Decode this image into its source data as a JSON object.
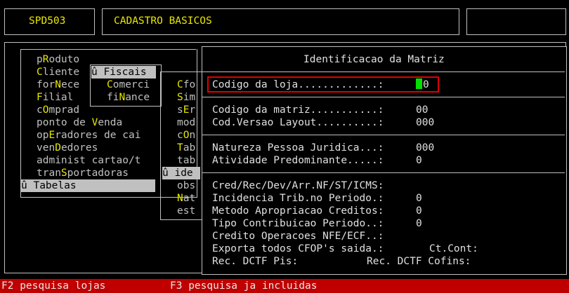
{
  "header": {
    "program_code": "SPD503",
    "screen_title": "CADASTRO BASICOS"
  },
  "main_menu": {
    "items": [
      {
        "prefix": "p",
        "hot": "R",
        "rest": "oduto"
      },
      {
        "prefix": "",
        "hot": "C",
        "rest": "liente"
      },
      {
        "prefix": "for",
        "hot": "N",
        "rest": "ece"
      },
      {
        "prefix": "",
        "hot": "F",
        "rest": "ilial"
      },
      {
        "prefix": "c",
        "hot": "O",
        "rest": "mprad"
      },
      {
        "prefix": "ponto de ",
        "hot": "V",
        "rest": "enda"
      },
      {
        "prefix": "op",
        "hot": "E",
        "rest": "radores de cai"
      },
      {
        "prefix": "ven",
        "hot": "D",
        "rest": "edores"
      },
      {
        "prefix": "administ cartao/t",
        "hot": "",
        "rest": ""
      },
      {
        "prefix": "tran",
        "hot": "S",
        "rest": "portadoras"
      }
    ],
    "selected": "û Tabelas"
  },
  "sub_menu_1": {
    "selected": "û Fiscais",
    "items": [
      {
        "prefix": "",
        "hot": "C",
        "rest": "omerci"
      },
      {
        "prefix": "fi",
        "hot": "N",
        "rest": "ance"
      }
    ]
  },
  "sub_menu_2": {
    "items": [
      {
        "prefix": "",
        "hot": "C",
        "rest": "fo"
      },
      {
        "prefix": "",
        "hot": "S",
        "rest": "im"
      },
      {
        "prefix": "s",
        "hot": "E",
        "rest": "r"
      },
      {
        "prefix": "mod",
        "hot": "",
        "rest": ""
      },
      {
        "prefix": "c",
        "hot": "O",
        "rest": "n"
      },
      {
        "prefix": "",
        "hot": "T",
        "rest": "ab"
      },
      {
        "prefix": "tab",
        "hot": "",
        "rest": ""
      }
    ],
    "selected": "û ide",
    "items_after": [
      {
        "prefix": "obs",
        "hot": "",
        "rest": ""
      },
      {
        "prefix": "",
        "hot": "N",
        "rest": "at"
      },
      {
        "prefix": "est",
        "hot": "",
        "rest": ""
      }
    ]
  },
  "dialog": {
    "title": "Identificacao da Matriz",
    "codigo_loja_label": "Codigo da loja.............:",
    "codigo_loja_value": "0",
    "section2": [
      {
        "label": "Codigo da matriz...........:",
        "value": "00"
      },
      {
        "label": "Cod.Versao Layout..........:",
        "value": "000"
      }
    ],
    "section3": [
      {
        "label": "Natureza Pessoa Juridica...:",
        "value": "000"
      },
      {
        "label": "Atividade Predominante.....:",
        "value": "0"
      }
    ],
    "section4": [
      {
        "label": "Cred/Rec/Dev/Arr.NF/ST/ICMS:",
        "value": ""
      },
      {
        "label": "Incidencia Trib.no Periodo.:",
        "value": "0"
      },
      {
        "label": "Metodo Apropriacao Creditos:",
        "value": "0"
      },
      {
        "label": "Tipo Contribuicao Periodo..:",
        "value": "0"
      },
      {
        "label": "Credito Operacoes NFE/ECF..:",
        "value": ""
      }
    ],
    "exporta_label": "Exporta todos CFOP's saida.:",
    "ct_cont_label": "Ct.Cont:",
    "rec_dctf_pis_label": "Rec. DCTF Pis:",
    "rec_dctf_cofins_label": "Rec. DCTF Cofins:"
  },
  "status_bar": {
    "f2": "F2 pesquisa lojas",
    "f3": "F3 pesquisa ja incluidas"
  },
  "colors": {
    "background": "#000000",
    "text": "#c0c0c0",
    "hotkey": "#e8e800",
    "status_bar": "#c00000",
    "focus_border": "#e00000",
    "cursor": "#00e000"
  }
}
